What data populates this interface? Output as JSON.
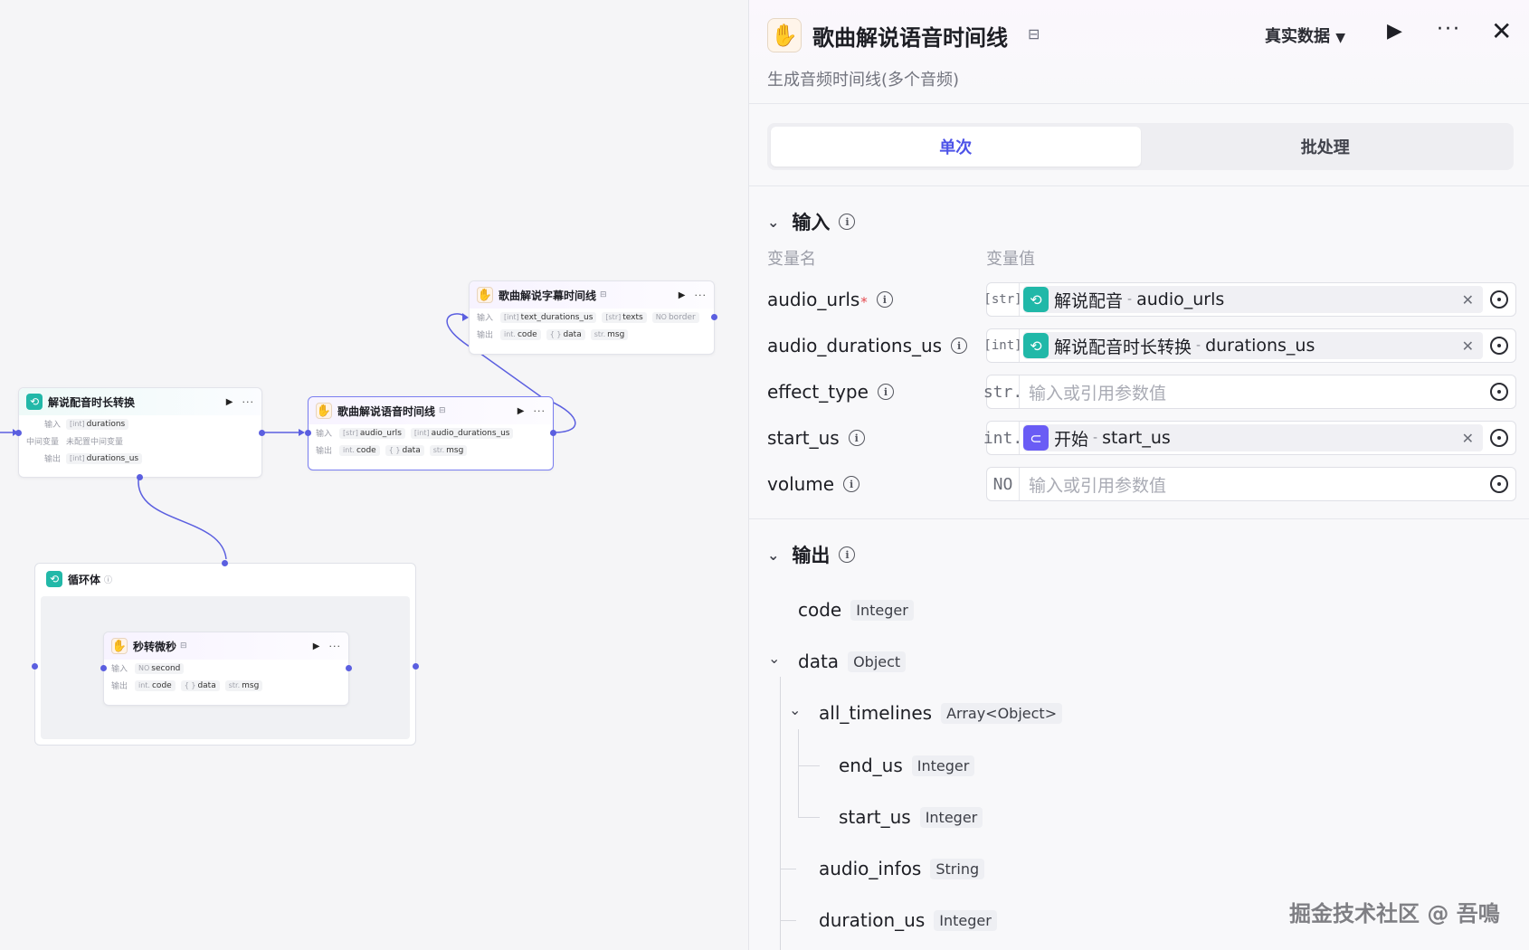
{
  "canvas": {
    "node_loop_convert": {
      "title": "解说配音时长转换",
      "rows": [
        {
          "label": "输入",
          "items": [
            {
              "type": "[int]",
              "name": "durations"
            }
          ]
        },
        {
          "label": "中间变量",
          "value": "未配置中间变量"
        },
        {
          "label": "输出",
          "items": [
            {
              "type": "[int]",
              "name": "durations_us"
            }
          ]
        }
      ]
    },
    "node_timeline": {
      "title": "歌曲解说语音时间线",
      "badge": "⊟",
      "rows": [
        {
          "label": "输入",
          "items": [
            {
              "type": "[str]",
              "name": "audio_urls"
            },
            {
              "type": "[int]",
              "name": "audio_durations_us"
            }
          ]
        },
        {
          "label": "输出",
          "items": [
            {
              "type": "int.",
              "name": "code"
            },
            {
              "type": "{ }",
              "name": "data"
            },
            {
              "type": "str.",
              "name": "msg"
            }
          ]
        }
      ]
    },
    "node_subtitle": {
      "title": "歌曲解说字幕时间线",
      "badge": "⊟",
      "rows": [
        {
          "label": "输入",
          "items": [
            {
              "type": "[int]",
              "name": "text_durations_us"
            },
            {
              "type": "[str]",
              "name": "texts"
            },
            {
              "type": "NO",
              "name": "border"
            }
          ]
        },
        {
          "label": "输出",
          "items": [
            {
              "type": "int.",
              "name": "code"
            },
            {
              "type": "{ }",
              "name": "data"
            },
            {
              "type": "str.",
              "name": "msg"
            }
          ]
        }
      ]
    },
    "loop_body": {
      "title": "循环体"
    },
    "node_sec": {
      "title": "秒转微秒",
      "badge": "⊟",
      "rows": [
        {
          "label": "输入",
          "items": [
            {
              "type": "NO",
              "name": "second"
            }
          ]
        },
        {
          "label": "输出",
          "items": [
            {
              "type": "int.",
              "name": "code"
            },
            {
              "type": "{ }",
              "name": "data"
            },
            {
              "type": "str.",
              "name": "msg"
            }
          ]
        }
      ]
    }
  },
  "panel": {
    "title": "歌曲解说语音时间线",
    "title_badge": "⊟",
    "subtitle": "生成音频时间线(多个音频)",
    "data_select": "真实数据",
    "tabs": [
      "单次",
      "批处理"
    ],
    "active_tab": "单次",
    "input_section": {
      "title": "输入",
      "col_name": "变量名",
      "col_value": "变量值",
      "vars": [
        {
          "name": "audio_urls",
          "required": true,
          "type": "[str]",
          "ref_node": "解说配音",
          "ref_var": "audio_urls",
          "ref_icon": "loop-icon"
        },
        {
          "name": "audio_durations_us",
          "required": false,
          "type": "[int]",
          "ref_node": "解说配音时长转换",
          "ref_var": "durations_us",
          "ref_icon": "loop-icon"
        },
        {
          "name": "effect_type",
          "required": false,
          "type": "str.",
          "placeholder": "输入或引用参数值"
        },
        {
          "name": "start_us",
          "required": false,
          "type": "int.",
          "ref_node": "开始",
          "ref_var": "start_us",
          "ref_icon": "start-icon"
        },
        {
          "name": "volume",
          "required": false,
          "type": "NO",
          "placeholder": "输入或引用参数值"
        }
      ]
    },
    "output_section": {
      "title": "输出",
      "fields": [
        {
          "name": "code",
          "type": "Integer"
        },
        {
          "name": "data",
          "type": "Object"
        },
        {
          "name": "all_timelines",
          "type": "Array<Object>"
        },
        {
          "name": "end_us",
          "type": "Integer"
        },
        {
          "name": "start_us",
          "type": "Integer"
        },
        {
          "name": "audio_infos",
          "type": "String"
        },
        {
          "name": "duration_us",
          "type": "Integer"
        }
      ]
    }
  },
  "watermark": "掘金技术社区 @ 吾鳴",
  "colors": {
    "accent": "#4d53e8",
    "wire": "#5b5fe0",
    "teal": "#20b8a8",
    "purple": "#6a5cf5"
  }
}
